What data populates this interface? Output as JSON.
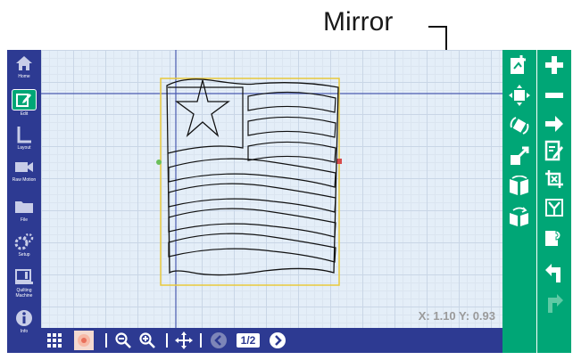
{
  "callout": {
    "label": "Mirror"
  },
  "left_nav": {
    "items": [
      {
        "label": "Home",
        "icon": "home-icon"
      },
      {
        "label": "Edit",
        "icon": "edit-icon",
        "active": true
      },
      {
        "label": "Layout",
        "icon": "layout-icon"
      },
      {
        "label": "Raw Motion",
        "icon": "camera-icon"
      },
      {
        "label": "File",
        "icon": "folder-icon"
      },
      {
        "label": "Setup",
        "icon": "gears-icon"
      },
      {
        "label": "Quilting Machine",
        "icon": "machine-icon"
      },
      {
        "label": "Info",
        "icon": "info-icon"
      }
    ]
  },
  "canvas": {
    "coords": "X: 1.10 Y: 0.93"
  },
  "bottom_bar": {
    "page": "1/2"
  },
  "tools_left": [
    "add-pattern-icon",
    "move-icon",
    "rotate-icon",
    "resize-icon",
    "mirror-horizontal-icon",
    "mirror-vertical-icon"
  ],
  "tools_right": [
    "plus-icon",
    "minus-icon",
    "arrow-right-icon",
    "edit-doc-icon",
    "crop-icon",
    "split-icon",
    "copy-icon",
    "undo-icon",
    "redo-icon"
  ],
  "colors": {
    "nav": "#2d3a92",
    "tools": "#00a676",
    "grid": "#e4eef8",
    "selection": "#e8c83a"
  }
}
